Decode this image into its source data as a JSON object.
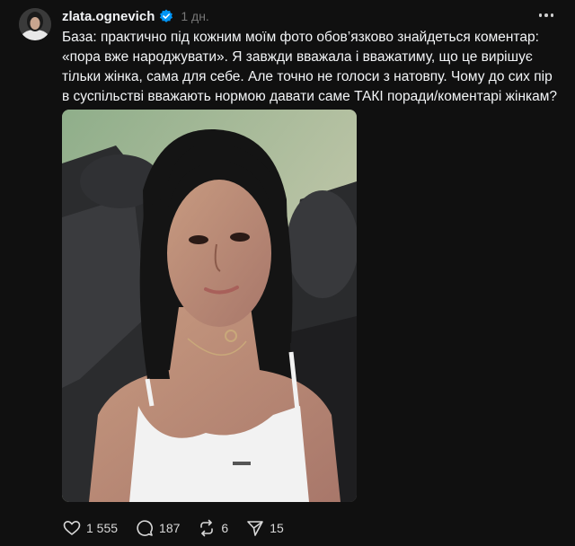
{
  "post": {
    "username": "zlata.ognevich",
    "time": "1 дн.",
    "caption": "База: практично під кожним моїм фото обов’язково знайдеться коментар: «пора вже народжувати». Я завжди вважала і вважатиму, що це вирішує тільки жінка, сама для себе. Але точно не голоси з натовпу. Чому до сих пір в суспільстві вважають нормою давати саме ТАКІ поради/коментарі жінкам?"
  },
  "actions": {
    "likes": "1 555",
    "comments": "187",
    "reposts": "6",
    "shares": "15"
  },
  "icons": {
    "verified": "verified-badge-icon",
    "more": "more-horizontal-icon",
    "like": "heart-icon",
    "comment": "comment-bubble-icon",
    "repost": "repost-arrows-icon",
    "share": "send-arrow-icon"
  },
  "colors": {
    "background": "#101010",
    "text": "#f3f5f7",
    "muted": "#777777",
    "verified": "#0095f6"
  }
}
